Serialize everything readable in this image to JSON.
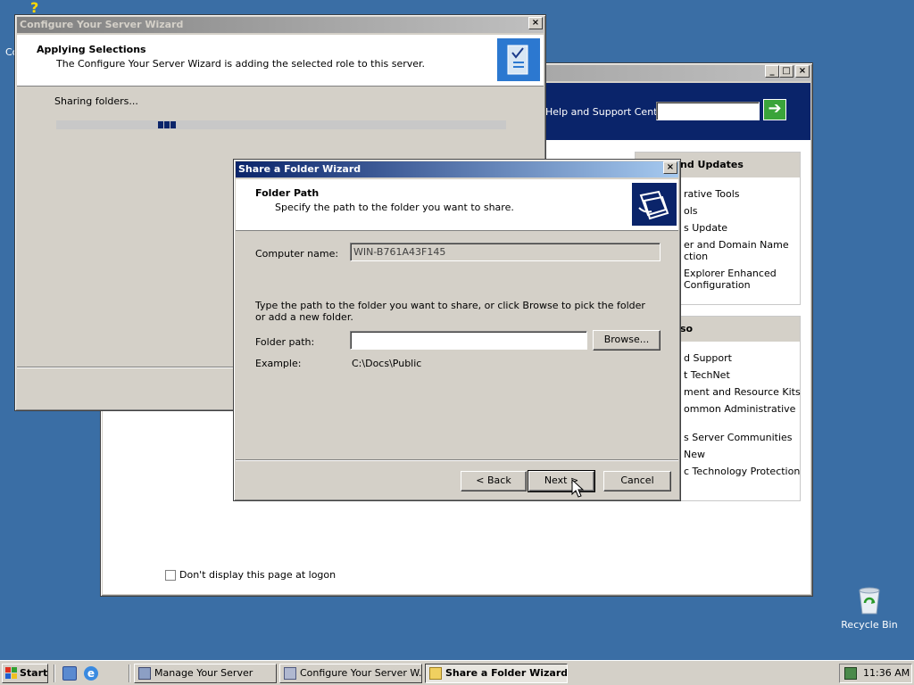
{
  "desktop": {
    "recycle_bin_label": "Recycle Bin",
    "corner_label": "Co"
  },
  "manage_server": {
    "help_search_label": "Help and Support Center",
    "right_panel_1": {
      "title": "nd Updates",
      "items": [
        "rative Tools",
        "ols",
        "s Update",
        "er and Domain Name",
        "ction",
        "Explorer Enhanced",
        "Configuration"
      ]
    },
    "right_panel_2": {
      "title": "so",
      "items": [
        "d Support",
        "t TechNet",
        "ment and Resource Kits",
        "ommon Administrative",
        "s Server Communities",
        "New",
        "c Technology Protection"
      ]
    },
    "dont_display_label": "Don't display this page at logon"
  },
  "config_wizard": {
    "title": "Configure Your Server Wizard",
    "heading": "Applying Selections",
    "subheading": "The Configure Your Server Wizard is adding the selected role to this server.",
    "status": "Sharing folders..."
  },
  "share_wizard": {
    "title": "Share a Folder Wizard",
    "heading": "Folder Path",
    "subheading": "Specify the path to the folder you want to share.",
    "computer_name_label": "Computer name:",
    "computer_name_value": "WIN-B761A43F145",
    "instructions": "Type the path to the folder you want to share, or click Browse to pick the folder or add a new folder.",
    "folder_path_label": "Folder path:",
    "folder_path_value": "",
    "browse_label": "Browse...",
    "example_label": "Example:",
    "example_value": "C:\\Docs\\Public",
    "back_label": "< Back",
    "next_label": "Next >",
    "cancel_label": "Cancel"
  },
  "taskbar": {
    "start_label": "Start",
    "tasks": [
      {
        "label": "Manage Your Server"
      },
      {
        "label": "Configure Your Server W..."
      },
      {
        "label": "Share a Folder Wizard"
      }
    ],
    "clock": "11:36 AM"
  }
}
